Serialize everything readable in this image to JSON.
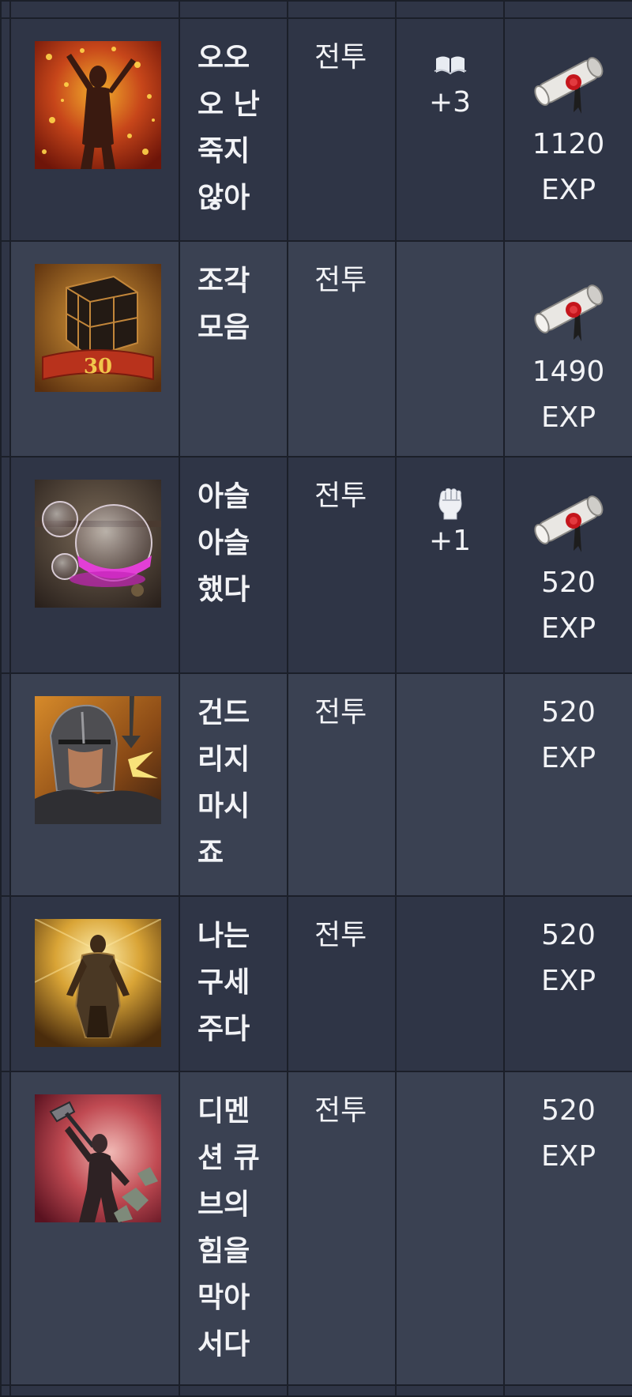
{
  "table": {
    "type_label": "전투",
    "exp_unit": "EXP",
    "rows": [
      {
        "name": "오오\n오 난\n죽지\n않아",
        "type": "전투",
        "bonus": {
          "icon": "book-icon",
          "value": "+3"
        },
        "reward": {
          "icon": "scroll-icon",
          "amount": "1120",
          "unit": "EXP"
        },
        "image": "arms-raised-figure-golden-rain"
      },
      {
        "name": "조각\n모음",
        "type": "전투",
        "bonus": null,
        "reward": {
          "icon": "scroll-icon",
          "amount": "1490",
          "unit": "EXP"
        },
        "image": "cube-banner-30"
      },
      {
        "name": "아슬\n아슬\n했다",
        "type": "전투",
        "bonus": {
          "icon": "fist-icon",
          "value": "+1"
        },
        "reward": {
          "icon": "scroll-icon",
          "amount": "520",
          "unit": "EXP"
        },
        "image": "glass-flask-pink-liquid"
      },
      {
        "name": "건드\n리지\n마시\n죠",
        "type": "전투",
        "bonus": null,
        "reward": {
          "icon": null,
          "amount": "520",
          "unit": "EXP"
        },
        "image": "armored-warrior-helmet"
      },
      {
        "name": "나는\n구세\n주다",
        "type": "전투",
        "bonus": null,
        "reward": {
          "icon": null,
          "amount": "520",
          "unit": "EXP"
        },
        "image": "armored-figure-golden-light"
      },
      {
        "name": "디멘\n션 큐\n브의\n힘을\n막아\n서다",
        "type": "전투",
        "bonus": null,
        "reward": {
          "icon": null,
          "amount": "520",
          "unit": "EXP"
        },
        "image": "figure-swinging-hammer"
      }
    ]
  },
  "colors": {
    "row_dark": "#2f3546",
    "row_light": "#3a4152",
    "border": "#1b1f29",
    "text": "#f2f3f6"
  }
}
